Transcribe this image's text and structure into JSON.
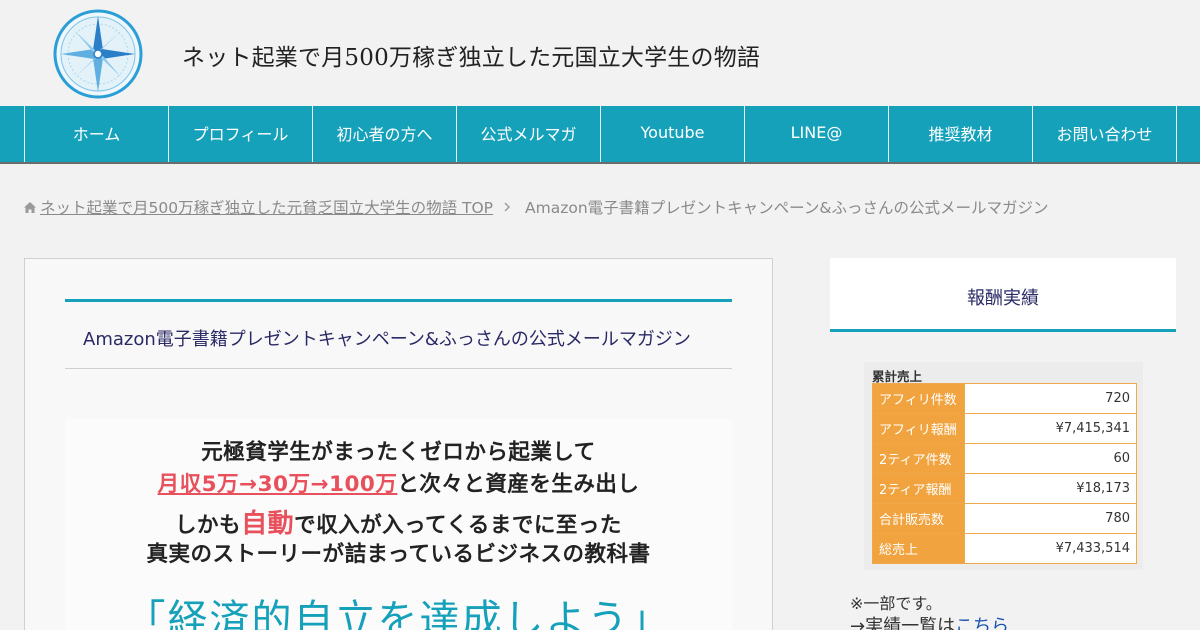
{
  "header": {
    "site_title": "ネット起業で月500万稼ぎ独立した元国立大学生の物語"
  },
  "nav": {
    "items": [
      "ホーム",
      "プロフィール",
      "初心者の方へ",
      "公式メルマガ",
      "Youtube",
      "LINE@",
      "推奨教材",
      "お問い合わせ"
    ]
  },
  "breadcrumb": {
    "home_link": "ネット起業で月500万稼ぎ独立した元貧乏国立大学生の物語 TOP",
    "current": "Amazon電子書籍プレゼントキャンペーン&ふっさんの公式メールマガジン"
  },
  "article": {
    "title": "Amazon電子書籍プレゼントキャンペーン&ふっさんの公式メールマガジン",
    "banner": {
      "line1": "元極貧学生がまったくゼロから起業して",
      "line2_highlight": "月収5万→30万→100万",
      "line2_rest": "と次々と資産を生み出し",
      "line3_pre": "しかも",
      "line3_highlight": "自動",
      "line3_rest": "で収入が入ってくるまでに至った",
      "line4": "真実のストーリーが詰まっているビジネスの教科書",
      "headline": "「経済的自立を達成しよう」"
    }
  },
  "sidebar": {
    "widget_title": "報酬実績",
    "stats": {
      "title": "累計売上",
      "rows": [
        {
          "label": "アフィリ件数",
          "value": "720"
        },
        {
          "label": "アフィリ報酬",
          "value": "¥7,415,341"
        },
        {
          "label": "2ティア件数",
          "value": "60"
        },
        {
          "label": "2ティア報酬",
          "value": "¥18,173"
        },
        {
          "label": "合計販売数",
          "value": "780"
        },
        {
          "label": "総売上",
          "value": "¥7,433,514"
        }
      ]
    },
    "note": "※一部です。",
    "list_prefix": "→実績一覧は",
    "list_link": "こちら"
  },
  "colors": {
    "accent": "#16a1ba",
    "table_label": "#f0a33e",
    "highlight_red": "#e8505b",
    "link": "#1a53b0"
  }
}
